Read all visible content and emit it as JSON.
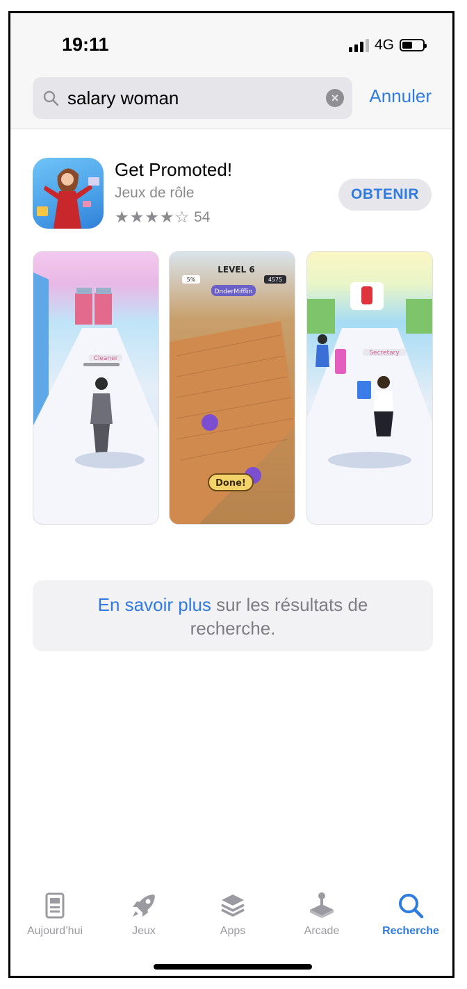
{
  "status_bar": {
    "time": "19:11",
    "network": "4G",
    "battery_level": 0.5
  },
  "search": {
    "query": "salary woman",
    "cancel_label": "Annuler"
  },
  "app": {
    "name": "Get Promoted!",
    "category": "Jeux de rôle",
    "stars_display": "★★★★☆",
    "rating_stars": 4,
    "rating_count": "54",
    "get_label": "OBTENIR"
  },
  "screenshots": {
    "shot2_level": "LEVEL 6",
    "shot2_done": "Done!",
    "shot2_company": "DnderMifflin",
    "shot2_money": "4575",
    "shot2_percent": "5%",
    "shot1_label": "Cleaner",
    "shot3_label": "Secretary"
  },
  "info": {
    "link_text": "En savoir plus",
    "rest_line1": " sur les résultats de",
    "line2": "recherche."
  },
  "tabbar": {
    "items": [
      {
        "label": "Aujourd’hui",
        "icon": "today-icon"
      },
      {
        "label": "Jeux",
        "icon": "rocket-icon"
      },
      {
        "label": "Apps",
        "icon": "apps-stack-icon"
      },
      {
        "label": "Arcade",
        "icon": "joystick-icon"
      },
      {
        "label": "Recherche",
        "icon": "search-icon"
      }
    ],
    "active_index": 4
  },
  "colors": {
    "accent": "#2f7be0",
    "inactive": "#9a9aa0"
  }
}
